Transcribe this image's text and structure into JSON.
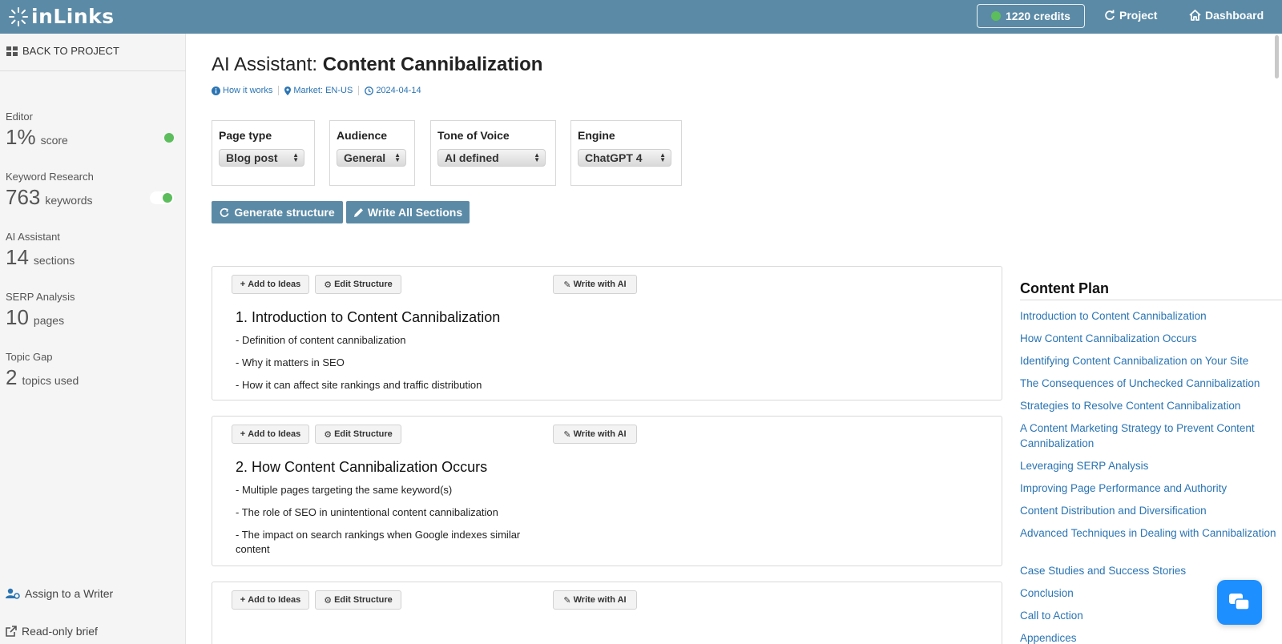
{
  "brand": {
    "name": "inLinks",
    "primary_color": "#5b8aa6",
    "link_color": "#2a74b3",
    "ok_color": "#5cbd5c"
  },
  "topbar": {
    "credits": "1220 credits",
    "project": "Project",
    "dashboard": "Dashboard"
  },
  "sidebar": {
    "back": "BACK TO PROJECT",
    "stats": [
      {
        "label": "Editor",
        "value": "1%",
        "unit": "score"
      },
      {
        "label": "Keyword Research",
        "value": "763",
        "unit": "keywords"
      },
      {
        "label": "AI Assistant",
        "value": "14",
        "unit": "sections"
      },
      {
        "label": "SERP Analysis",
        "value": "10",
        "unit": "pages"
      },
      {
        "label": "Topic Gap",
        "value": "2",
        "unit": "topics used"
      }
    ],
    "assign": "Assign to a Writer",
    "readonly": "Read-only brief"
  },
  "main": {
    "title_prefix": "AI Assistant:",
    "title": "Content Cannibalization",
    "meta": {
      "how": "How it works",
      "market": "Market: EN-US",
      "date": "2024-04-14"
    },
    "options": [
      {
        "label": "Page type",
        "value": "Blog post"
      },
      {
        "label": "Audience",
        "value": "General"
      },
      {
        "label": "Tone of Voice",
        "value": "AI defined"
      },
      {
        "label": "Engine",
        "value": "ChatGPT 4"
      }
    ],
    "generate_label": "Generate structure",
    "write_all_label": "Write All Sections",
    "section_buttons": {
      "add": "Add to Ideas",
      "edit": "Edit Structure",
      "write": "Write with AI"
    },
    "sections": [
      {
        "title": "1. Introduction to Content Cannibalization",
        "bullets": [
          "- Definition of content cannibalization",
          "- Why it matters in SEO",
          "- How it can affect site rankings and traffic distribution"
        ]
      },
      {
        "title": "2. How Content Cannibalization Occurs",
        "bullets": [
          "- Multiple pages targeting the same keyword(s)",
          "- The role of SEO in unintentional content cannibalization",
          "- The impact on search rankings when Google indexes similar content"
        ]
      }
    ]
  },
  "plan": {
    "title": "Content Plan",
    "items": [
      "Introduction to Content Cannibalization",
      "How Content Cannibalization Occurs",
      "Identifying Content Cannibalization on Your Site",
      "The Consequences of Unchecked Cannibalization",
      "Strategies to Resolve Content Cannibalization",
      "A Content Marketing Strategy to Prevent Content Cannibalization",
      "Leveraging SERP Analysis",
      "Improving Page Performance and Authority",
      "Content Distribution and Diversification",
      "Advanced Techniques in Dealing with Cannibalization",
      "Case Studies and Success Stories",
      "Conclusion",
      "Call to Action",
      "Appendices"
    ]
  }
}
